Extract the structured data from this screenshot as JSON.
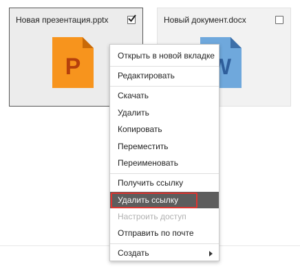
{
  "files": [
    {
      "name": "Новая презентация.pptx",
      "checked": true,
      "icon": "pptx-file-icon",
      "icon_letter": "P",
      "color": "#f7941d"
    },
    {
      "name": "Новый документ.docx",
      "checked": false,
      "icon": "docx-file-icon",
      "icon_letter": "W",
      "color": "#6fa8dc"
    }
  ],
  "context_menu": {
    "items": [
      {
        "label": "Открыть в новой вкладке"
      },
      {
        "label": "Редактировать"
      },
      {
        "label": "Скачать"
      },
      {
        "label": "Удалить"
      },
      {
        "label": "Копировать"
      },
      {
        "label": "Переместить"
      },
      {
        "label": "Переименовать"
      },
      {
        "label": "Получить ссылку"
      },
      {
        "label": "Удалить ссылку",
        "state": "hover"
      },
      {
        "label": "Настроить доступ",
        "state": "disabled"
      },
      {
        "label": "Отправить по почте"
      },
      {
        "label": "Создать",
        "submenu": true
      }
    ]
  },
  "colors": {
    "menu_hover": "#5d5d5d",
    "highlight_border": "#e0342f"
  }
}
